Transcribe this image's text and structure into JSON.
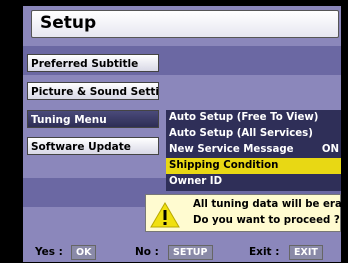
{
  "header": {
    "title": "Setup"
  },
  "menu": {
    "items": [
      {
        "label": "Preferred Subtitle"
      },
      {
        "label": "Picture & Sound Setting"
      },
      {
        "label": "Tuning Menu",
        "selected": true
      },
      {
        "label": "Software Update"
      }
    ]
  },
  "submenu": {
    "items": [
      {
        "label": "Auto Setup (Free To View)",
        "value": ""
      },
      {
        "label": "Auto Setup (All Services)",
        "value": ""
      },
      {
        "label": "New Service Message",
        "value": "ON"
      },
      {
        "label": "Shipping Condition",
        "value": "",
        "highlighted": true
      },
      {
        "label": "Owner ID",
        "value": ""
      }
    ]
  },
  "warning": {
    "icon": "warning-icon",
    "line1": "All tuning data will be erased.",
    "line2": "Do you want to proceed ?"
  },
  "footer": {
    "yes_label": "Yes :",
    "yes_key": "OK",
    "no_label": "No :",
    "no_key": "SETUP",
    "exit_label": "Exit :",
    "exit_key": "EXIT"
  },
  "colors": {
    "background": "#8b87bb",
    "highlight": "#e8d814",
    "submenu_bg": "#2f2f58",
    "warning_bg": "#fffbd0"
  }
}
